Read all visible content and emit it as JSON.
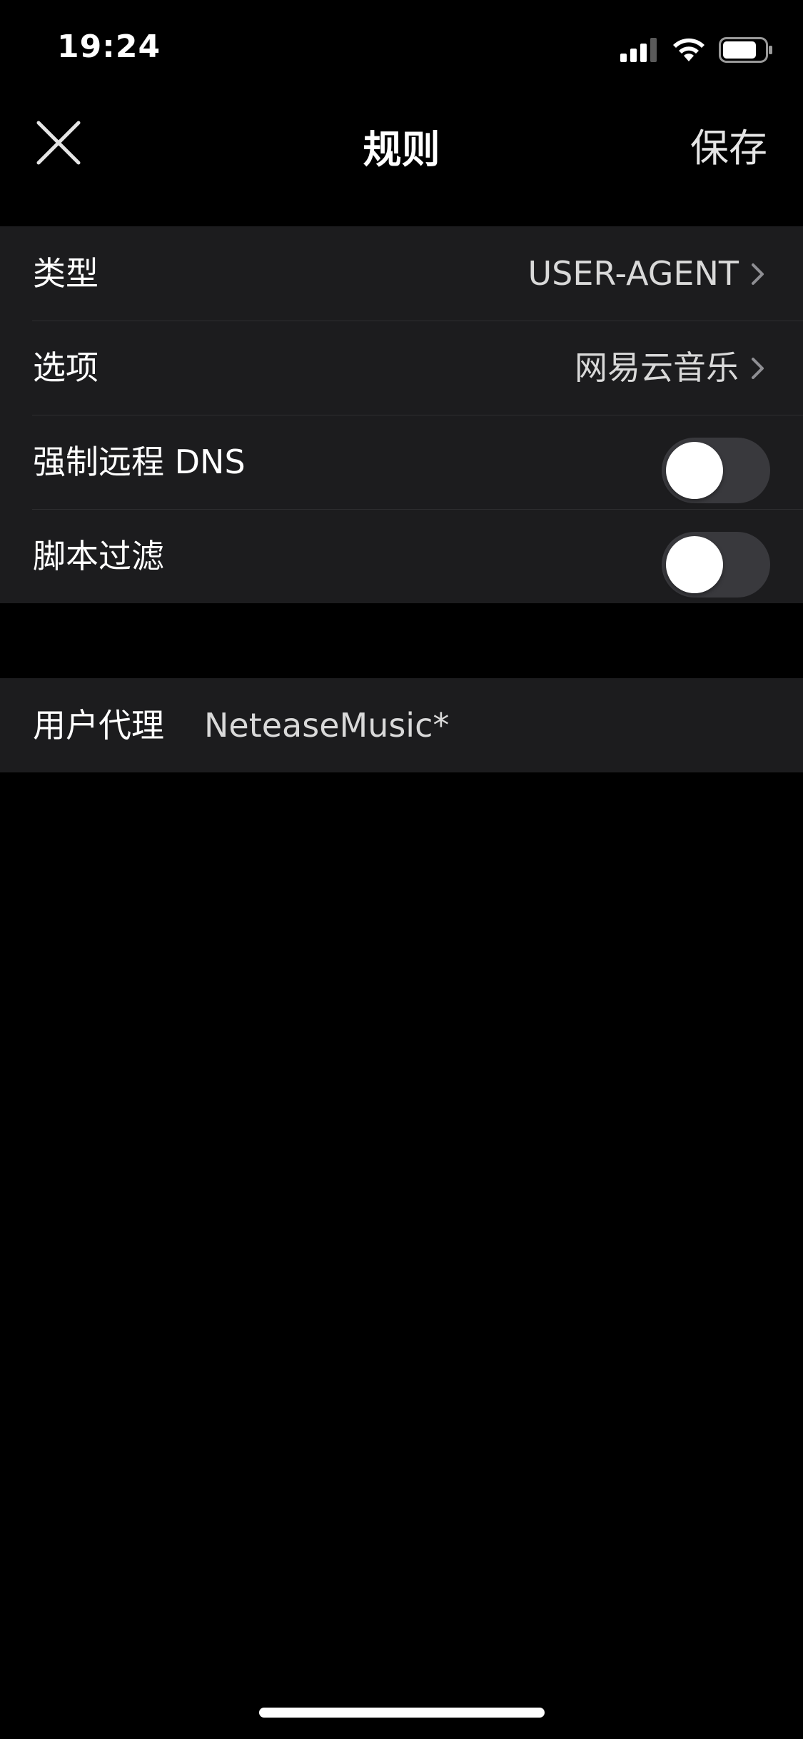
{
  "status_bar": {
    "time": "19:24",
    "icons": [
      "cellular-signal-icon",
      "wifi-icon",
      "battery-icon"
    ],
    "battery_level": 0.75
  },
  "nav": {
    "title": "规则",
    "save_label": "保存",
    "close_icon": "close-icon"
  },
  "rules": {
    "type_label": "类型",
    "type_value": "USER-AGENT",
    "option_label": "选项",
    "option_value": "网易云音乐",
    "force_remote_dns_label": "强制远程 DNS",
    "force_remote_dns_enabled": false,
    "script_filter_label": "脚本过滤",
    "script_filter_enabled": false
  },
  "user_agent": {
    "label": "用户代理",
    "value": "NeteaseMusic*"
  },
  "colors": {
    "background": "#000000",
    "group_background": "#1c1c1e",
    "toggle_off": "#39393d",
    "text": "#ffffff",
    "secondary_text": "#d9d9d9"
  }
}
